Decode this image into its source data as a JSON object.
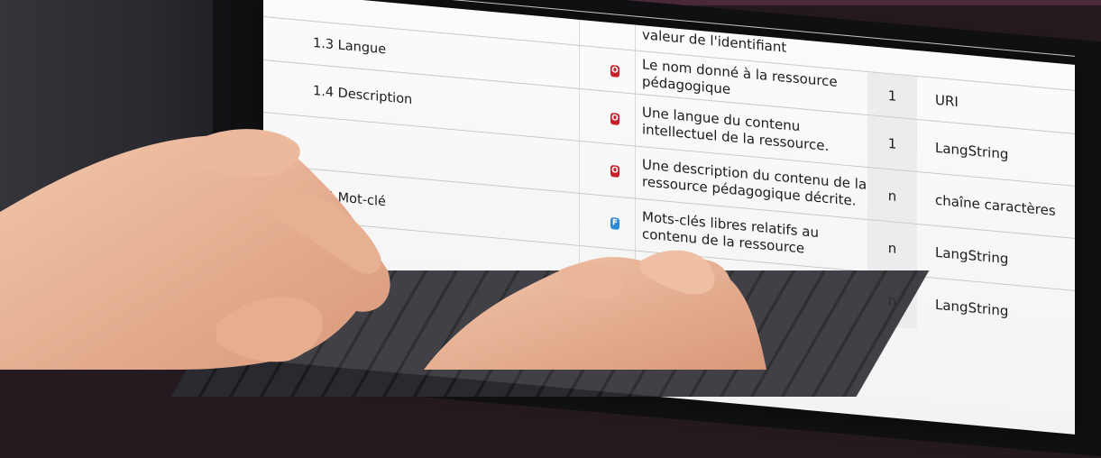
{
  "table": {
    "rows": [
      {
        "name": "",
        "badge": "",
        "badge_type": "",
        "desc": "valeur de l'identifiant",
        "card": "",
        "type": ""
      },
      {
        "name": "1.3 Langue",
        "badge": "O",
        "badge_type": "o",
        "desc": "Le nom donné à la ressource pédagogique",
        "card": "1",
        "type": "URI"
      },
      {
        "name": "1.4 Description",
        "badge": "O",
        "badge_type": "o",
        "desc": "Une langue du contenu intellectuel de la ressource.",
        "card": "1",
        "type": "LangString"
      },
      {
        "name": "",
        "badge": "O",
        "badge_type": "o",
        "desc": "Une description du contenu de la ressource pédagogique décrite.",
        "card": "n",
        "type": "chaîne caractères"
      },
      {
        "name": "1.5 Mot-clé",
        "badge": "F",
        "badge_type": "f",
        "desc": "Mots-clés libres relatifs au contenu de la ressource",
        "card": "n",
        "type": "LangString"
      },
      {
        "name": "",
        "badge": "",
        "badge_type": "",
        "desc": "",
        "card": "n",
        "type": "LangString"
      }
    ]
  },
  "colors": {
    "badge_o": "#c8202a",
    "badge_f": "#2a8ad8",
    "screen_bg": "#f7f7f7",
    "bezel": "#111114",
    "skin": "#e9b59a"
  }
}
